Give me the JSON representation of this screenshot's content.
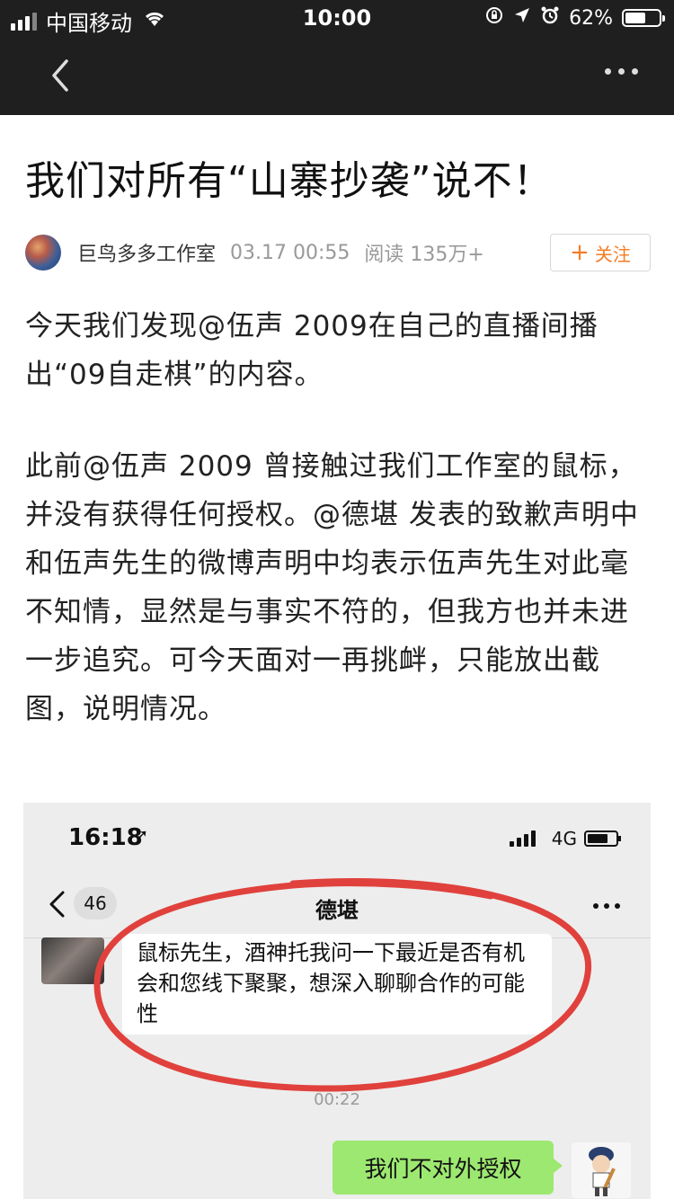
{
  "status_bar": {
    "carrier": "中国移动",
    "time": "10:00",
    "battery_percent": "62%",
    "battery_level": 0.62,
    "icons": [
      "signal-icon",
      "wifi-icon",
      "lock-rotation-icon",
      "location-icon",
      "alarm-icon",
      "battery-icon"
    ]
  },
  "nav": {
    "back_icon": "back-chevron-icon",
    "more_icon": "more-dots-icon"
  },
  "article": {
    "title": "我们对所有“山寨抄袭”说不！",
    "author": "巨鸟多多工作室",
    "date": "03.17 00:55",
    "reads": "阅读 135万+",
    "follow_label": "关注",
    "follow_plus": "+",
    "paragraphs": [
      "今天我们发现@伍声 2009在自己的直播间播出“09自走棋”的内容。",
      "此前@伍声 2009 曾接触过我们工作室的鼠标，并没有获得任何授权。@德堪 发表的致歉声明中和伍声先生的微博声明中均表示伍声先生对此毫不知情，显然是与事实不符的，但我方也并未进一步追究。可今天面对一再挑衅，只能放出截图，说明情况。"
    ]
  },
  "screenshot": {
    "time": "16:18",
    "location_arrow": "➚",
    "network": "4G",
    "unread_count": "46",
    "chat_title": "德堪",
    "incoming_message": "鼠标先生，酒神托我问一下最近是否有机会和您线下聚聚，想深入聊聊合作的可能性",
    "timestamp": "00:22",
    "outgoing_message": "我们不对外授权",
    "highlight_color": "#e0413c",
    "bubble_color": "#9de870"
  }
}
